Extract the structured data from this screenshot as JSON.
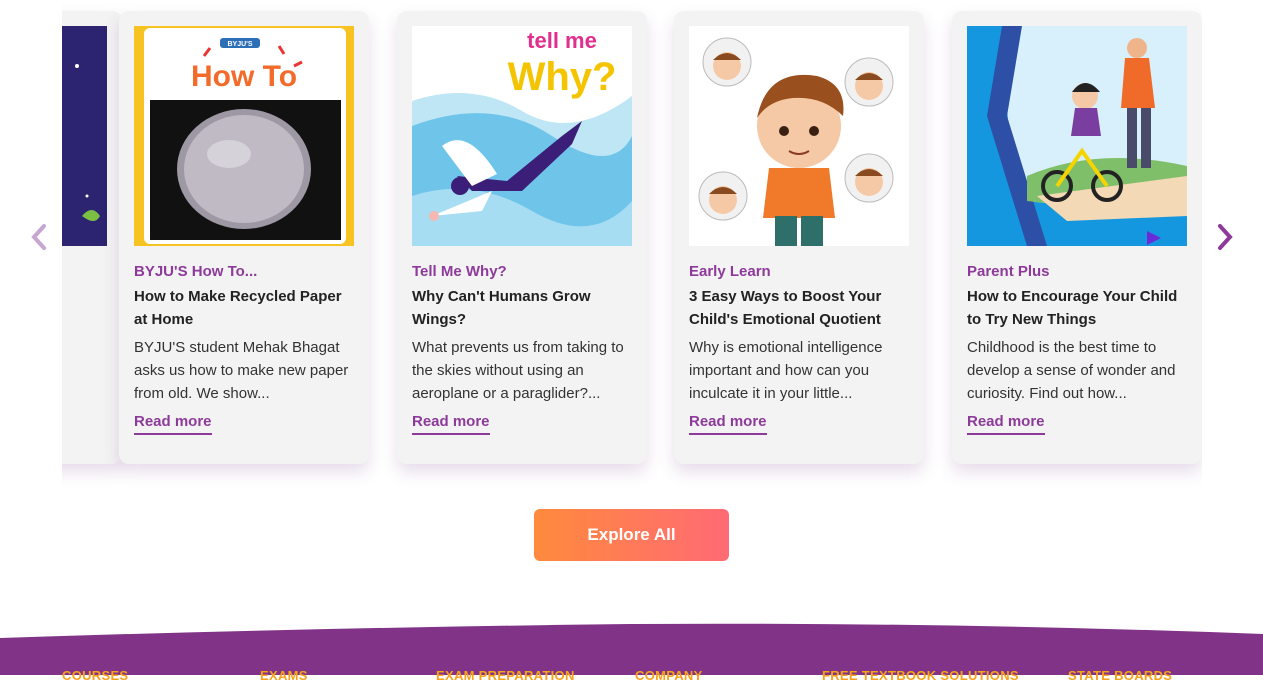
{
  "cards": [
    {
      "category": "BYJU'S How To...",
      "title": "How to Make Recycled Paper at Home",
      "description": "BYJU'S student Mehak Bhagat asks us how to make new paper from old. We show...",
      "read_more": "Read more",
      "image": {
        "logo_badge": "BYJU'S",
        "logo_text": "How To"
      }
    },
    {
      "category": "Tell Me Why?",
      "title": "Why Can't Humans Grow Wings?",
      "description": "What prevents us from taking to the skies without using an aeroplane or a paraglider?...",
      "read_more": "Read more",
      "image": {
        "logo_line1": "tell me",
        "logo_line2": "Why?"
      }
    },
    {
      "category": "Early Learn",
      "title": "3 Easy Ways to Boost Your Child's Emotional Quotient",
      "description": "Why is emotional intelligence important and how can you inculcate it in your little...",
      "read_more": "Read more"
    },
    {
      "category": "Parent Plus",
      "title": "How to Encourage Your Child to Try New Things",
      "description": "Childhood is the best time to develop a sense of wonder and curiosity. Find out how...",
      "read_more": "Read more"
    }
  ],
  "explore_label": "Explore All",
  "footer": {
    "headings": [
      "COURSES",
      "EXAMS",
      "EXAM PREPARATION",
      "COMPANY",
      "FREE TEXTBOOK SOLUTIONS",
      "STATE BOARDS"
    ]
  },
  "colors": {
    "brand_purple": "#8d3a9a",
    "footer_purple": "#813487",
    "footer_heading": "#f7a21b",
    "button_start": "#ff8a3d",
    "button_end": "#ff6a74"
  },
  "icons": {
    "prev": "chevron-left-icon",
    "next": "chevron-right-icon"
  }
}
